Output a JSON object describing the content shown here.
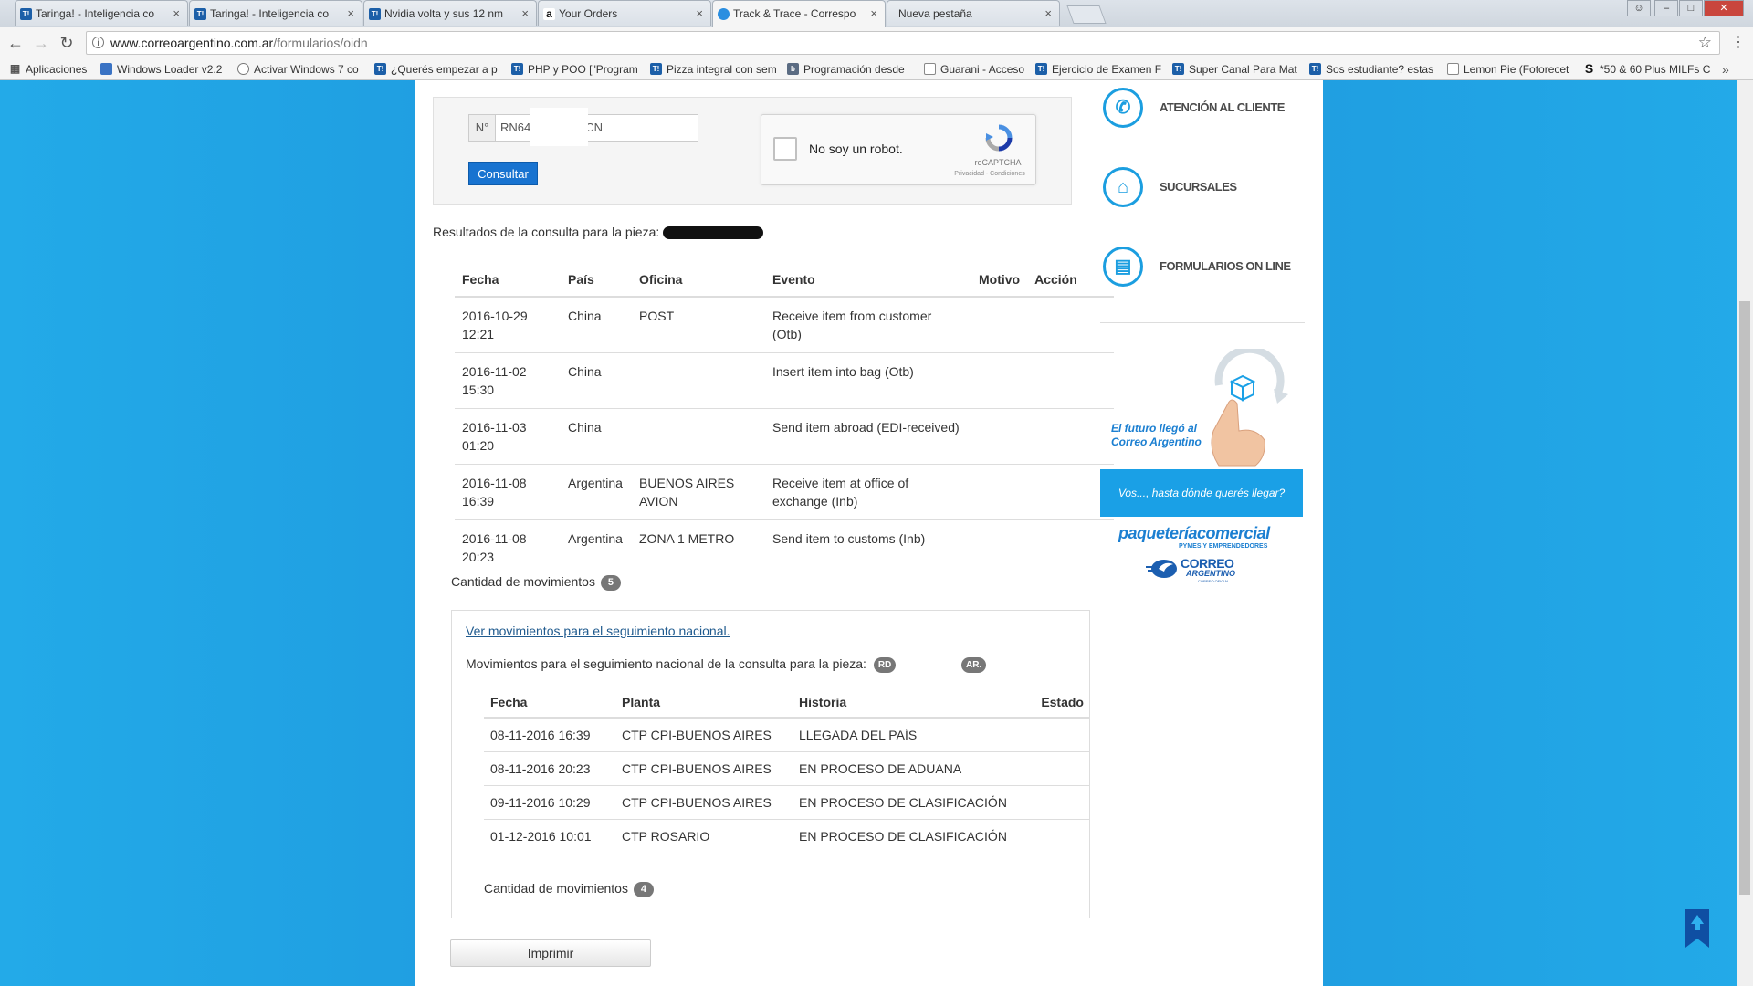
{
  "browser": {
    "tabs": [
      {
        "title": "Taringa! - Inteligencia co",
        "icon": "T!"
      },
      {
        "title": "Taringa! - Inteligencia co",
        "icon": "T!"
      },
      {
        "title": "Nvidia volta y sus 12 nm",
        "icon": "T!"
      },
      {
        "title": "Your Orders",
        "icon": "a"
      },
      {
        "title": "Track & Trace - Correspo",
        "icon": ""
      },
      {
        "title": "Nueva pestaña",
        "icon": ""
      }
    ],
    "close_glyph": "×",
    "url_host": "www.correoargentino.com.ar",
    "url_path": "/formularios/oidn",
    "bookmarks": [
      "Aplicaciones",
      "Windows Loader v2.2",
      "Activar Windows 7 co",
      "¿Querés empezar a p",
      "PHP y POO [\"Program",
      "Pizza integral con sem",
      "Programación desde",
      "Guarani - Acceso",
      "Ejercicio de Examen F",
      "Super Canal Para Mat",
      "Sos estudiante? estas",
      "Lemon Pie (Fotorecet",
      "*50 & 60 Plus MILFs C"
    ],
    "bookmarks_more": "»"
  },
  "form": {
    "prefix": "N°",
    "tracking_value_start": "RN64",
    "tracking_value_end": "CN",
    "submit_label": "Consultar",
    "captcha_label": "No soy un robot.",
    "captcha_brand": "reCAPTCHA",
    "captcha_terms": "Privacidad - Condiciones"
  },
  "results": {
    "heading": "Resultados de la consulta para la pieza:",
    "columns": [
      "Fecha",
      "País",
      "Oficina",
      "Evento",
      "Motivo",
      "Acción"
    ],
    "rows": [
      {
        "fecha": "2016-10-29 12:21",
        "pais": "China",
        "oficina": "POST",
        "evento": "Receive item from customer (Otb)",
        "motivo": "",
        "accion": ""
      },
      {
        "fecha": "2016-11-02 15:30",
        "pais": "China",
        "oficina": "",
        "evento": "Insert item into bag (Otb)",
        "motivo": "",
        "accion": ""
      },
      {
        "fecha": "2016-11-03 01:20",
        "pais": "China",
        "oficina": "",
        "evento": "Send item abroad (EDI-received)",
        "motivo": "",
        "accion": ""
      },
      {
        "fecha": "2016-11-08 16:39",
        "pais": "Argentina",
        "oficina": "BUENOS AIRES AVION",
        "evento": "Receive item at office of exchange (Inb)",
        "motivo": "",
        "accion": ""
      },
      {
        "fecha": "2016-11-08 20:23",
        "pais": "Argentina",
        "oficina": "ZONA 1 METRO",
        "evento": "Send item to customs (Inb)",
        "motivo": "",
        "accion": ""
      }
    ],
    "count_label": "Cantidad de movimientos",
    "count": "5"
  },
  "national": {
    "link_label": "Ver movimientos para el seguimiento nacional.",
    "title": "Movimientos para el seguimiento nacional de la consulta para la pieza:",
    "piece_prefix": "RD",
    "piece_suffix": "AR.",
    "columns": [
      "Fecha",
      "Planta",
      "Historia",
      "Estado"
    ],
    "rows": [
      {
        "fecha": "08-11-2016 16:39",
        "planta": "CTP CPI-BUENOS AIRES",
        "historia": "LLEGADA DEL PAÍS",
        "estado": ""
      },
      {
        "fecha": "08-11-2016 20:23",
        "planta": "CTP CPI-BUENOS AIRES",
        "historia": "EN PROCESO DE ADUANA",
        "estado": ""
      },
      {
        "fecha": "09-11-2016 10:29",
        "planta": "CTP CPI-BUENOS AIRES",
        "historia": "EN PROCESO DE CLASIFICACIÓN",
        "estado": ""
      },
      {
        "fecha": "01-12-2016 10:01",
        "planta": "CTP ROSARIO",
        "historia": "EN PROCESO DE CLASIFICACIÓN",
        "estado": ""
      }
    ],
    "count_label": "Cantidad de movimientos",
    "count": "4"
  },
  "print_label": "Imprimir",
  "sidebar": {
    "items": [
      {
        "label": "ATENCIÓN AL CLIENTE",
        "icon": "phone-icon"
      },
      {
        "label": "SUCURSALES",
        "icon": "branch-icon"
      },
      {
        "label": "FORMULARIOS ON LINE",
        "icon": "form-icon"
      }
    ]
  },
  "promo": {
    "line1": "El futuro llegó al",
    "line2": "Correo Argentino",
    "banner": "Vos..., hasta dónde querés llegar?",
    "paqueteria": "paqueteríacomercial",
    "pymes": "PYMES Y EMPRENDEDORES",
    "correo": "CORREO",
    "argentino": "ARGENTINO",
    "oficial": "CORREO OFICIAL"
  },
  "colors": {
    "accent": "#1b9ee0",
    "button_blue": "#1873d0",
    "page_background": "#1c93da"
  }
}
